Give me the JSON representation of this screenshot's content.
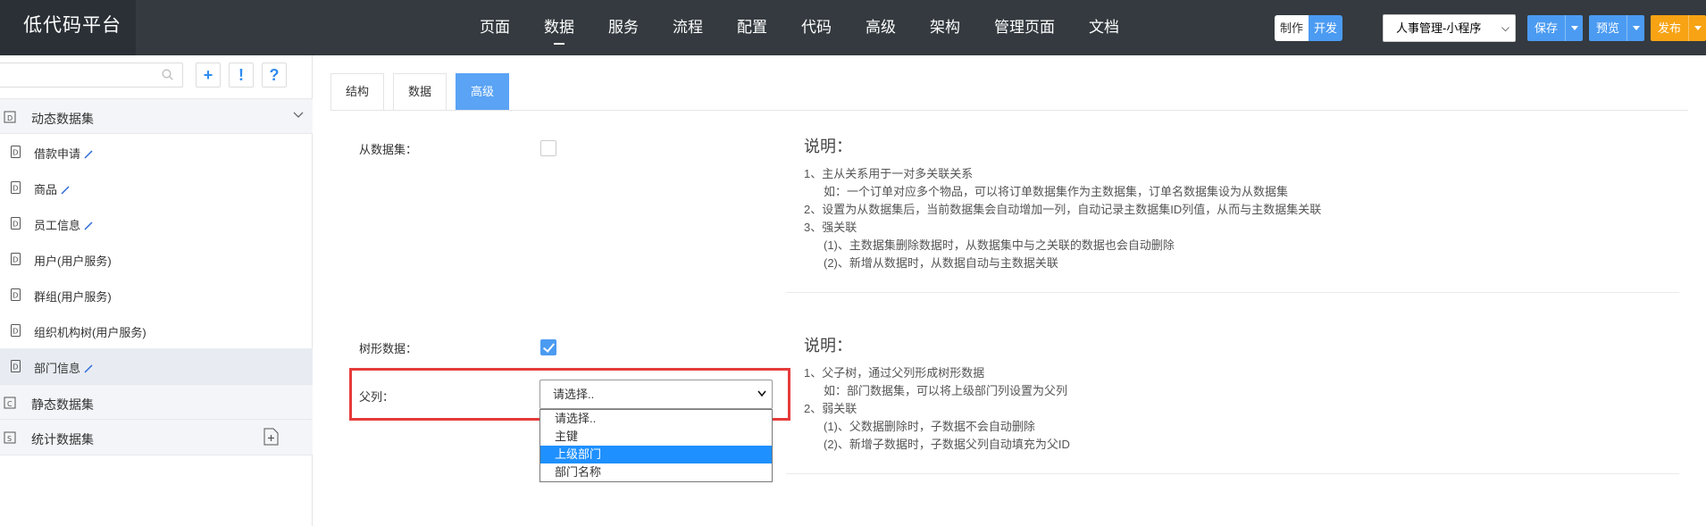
{
  "app": {
    "title": "低代码平台"
  },
  "nav": {
    "items": [
      "页面",
      "数据",
      "服务",
      "流程",
      "配置",
      "代码",
      "高级",
      "架构",
      "管理页面",
      "文档"
    ],
    "active_index": 1
  },
  "header_right": {
    "mode_make": "制作",
    "mode_dev": "开发",
    "app_select_value": "人事管理-小程序",
    "save": "保存",
    "preview": "预览",
    "publish": "发布"
  },
  "sidebar": {
    "tool_buttons": [
      "+",
      "!",
      "?"
    ],
    "groups": [
      {
        "label": "动态数据集",
        "icon": "dynamic-dataset-icon"
      },
      {
        "label": "静态数据集",
        "icon": "static-dataset-icon"
      },
      {
        "label": "统计数据集",
        "icon": "stat-dataset-icon"
      }
    ],
    "items": [
      {
        "label": "借款申请",
        "editable": true
      },
      {
        "label": "商品",
        "editable": true
      },
      {
        "label": "员工信息",
        "editable": true
      },
      {
        "label": "用户(用户服务)",
        "editable": false
      },
      {
        "label": "群组(用户服务)",
        "editable": false
      },
      {
        "label": "组织机构树(用户服务)",
        "editable": false
      },
      {
        "label": "部门信息",
        "editable": true,
        "selected": true
      }
    ]
  },
  "tabs": {
    "items": [
      "结构",
      "数据",
      "高级"
    ],
    "active_index": 2
  },
  "form": {
    "sub_dataset_label": "从数据集：",
    "sub_dataset_checked": false,
    "tree_data_label": "树形数据：",
    "tree_data_checked": true,
    "parent_column_label": "父列：",
    "parent_column_placeholder": "请选择..",
    "parent_column_options": [
      "请选择..",
      "主键",
      "上级部门",
      "部门名称"
    ],
    "parent_column_highlighted": 2
  },
  "desc1": {
    "title": "说明：",
    "lines": [
      {
        "text": "1、主从关系用于一对多关联关系",
        "indent": false
      },
      {
        "text": "如：一个订单对应多个物品，可以将订单数据集作为主数据集，订单名数据集设为从数据集",
        "indent": true
      },
      {
        "text": "2、设置为从数据集后，当前数据集会自动增加一列，自动记录主数据集ID列值，从而与主数据集关联",
        "indent": false
      },
      {
        "text": "3、强关联",
        "indent": false
      },
      {
        "text": "(1)、主数据集删除数据时，从数据集中与之关联的数据也会自动删除",
        "indent": true
      },
      {
        "text": "(2)、新增从数据时，从数据自动与主数据关联",
        "indent": true
      }
    ]
  },
  "desc2": {
    "title": "说明：",
    "lines": [
      {
        "text": "1、父子树，通过父列形成树形数据",
        "indent": false
      },
      {
        "text": "如：部门数据集，可以将上级部门列设置为父列",
        "indent": true
      },
      {
        "text": "2、弱关联",
        "indent": false
      },
      {
        "text": "(1)、父数据删除时，子数据不会自动删除",
        "indent": true
      },
      {
        "text": "(2)、新增子数据时，子数据父列自动填充为父ID",
        "indent": true
      }
    ]
  },
  "colors": {
    "topbar": "#343a3f",
    "accent": "#4b9bf2",
    "publish": "#f7a314",
    "highlight": "#e53b3b"
  }
}
